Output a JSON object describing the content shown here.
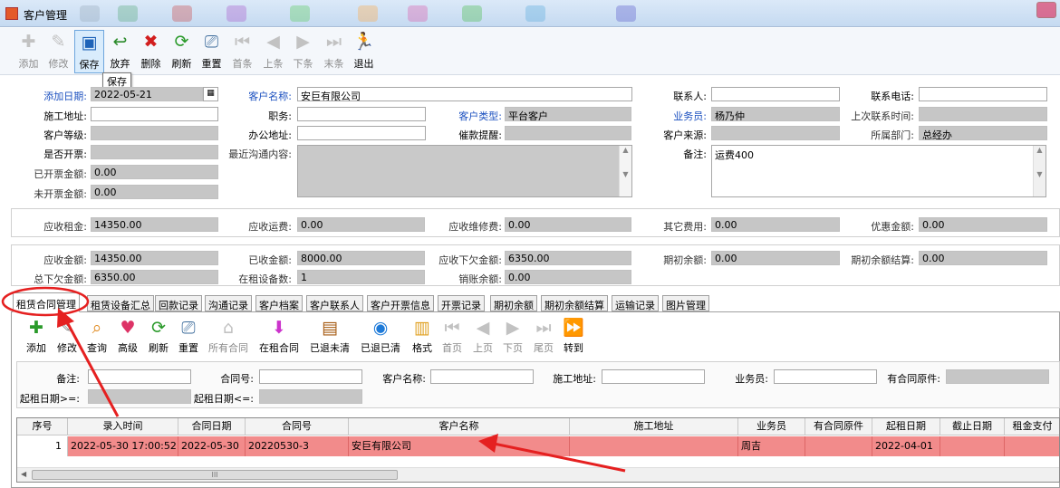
{
  "window": {
    "title": "客户管理"
  },
  "toolbar": {
    "buttons": [
      {
        "label": "添加",
        "icon": "plus-icon",
        "enabled": false
      },
      {
        "label": "修改",
        "icon": "edit-icon",
        "enabled": false
      },
      {
        "label": "保存",
        "icon": "save-icon",
        "enabled": true
      },
      {
        "label": "放弃",
        "icon": "undo-icon",
        "enabled": true
      },
      {
        "label": "删除",
        "icon": "delete-icon",
        "enabled": true
      },
      {
        "label": "刷新",
        "icon": "refresh-icon",
        "enabled": true
      },
      {
        "label": "重置",
        "icon": "reset-icon",
        "enabled": true
      },
      {
        "label": "首条",
        "icon": "first-icon",
        "enabled": false
      },
      {
        "label": "上条",
        "icon": "prev-icon",
        "enabled": false
      },
      {
        "label": "下条",
        "icon": "next-icon",
        "enabled": false
      },
      {
        "label": "末条",
        "icon": "last-icon",
        "enabled": false
      },
      {
        "label": "退出",
        "icon": "exit-icon",
        "enabled": true
      }
    ],
    "tooltip": "保存"
  },
  "form": {
    "add_date_label": "添加日期:",
    "add_date": "2022-05-21",
    "customer_name_label": "客户名称:",
    "customer_name": "安巨有限公司",
    "contact_label": "联系人:",
    "contact": "",
    "phone_label": "联系电话:",
    "phone": "",
    "site_label": "施工地址:",
    "site": "",
    "position_label": "职务:",
    "position": "",
    "ctype_label": "客户类型:",
    "ctype": "平台客户",
    "salesman_label": "业务员:",
    "salesman": "杨乃仲",
    "last_contact_label": "上次联系时间:",
    "last_contact": "",
    "level_label": "客户等级:",
    "level": "",
    "office_label": "办公地址:",
    "office": "",
    "remind_label": "催款提醒:",
    "remind": "",
    "source_label": "客户来源:",
    "source": "",
    "dept_label": "所属部门:",
    "dept": "总经办",
    "invoice_label": "是否开票:",
    "invoice": "",
    "recent_label": "最近沟通内容:",
    "recent": "",
    "note_label": "备注:",
    "note": "运费400",
    "invoiced_label": "已开票金额:",
    "invoiced": "0.00",
    "uninvoiced_label": "未开票金额:",
    "uninvoiced": "0.00"
  },
  "receivable": {
    "rent_label": "应收租金:",
    "rent": "14350.00",
    "freight_label": "应收运费:",
    "freight": "0.00",
    "repair_label": "应收维修费:",
    "repair": "0.00",
    "other_label": "其它费用:",
    "other": "0.00",
    "discount_label": "优惠金额:",
    "discount": "0.00"
  },
  "totals": {
    "total_label": "应收金额:",
    "total": "14350.00",
    "received_label": "已收金额:",
    "received": "8000.00",
    "owe_next_label": "应收下欠金额:",
    "owe_next": "6350.00",
    "opening_label": "期初余额:",
    "opening": "0.00",
    "opening_settle_label": "期初余额结算:",
    "opening_settle": "0.00",
    "total_owe_label": "总下欠金额:",
    "total_owe": "6350.00",
    "rented_count_label": "在租设备数:",
    "rented_count": "1",
    "writeoff_label": "销账余额:",
    "writeoff": "0.00"
  },
  "tabs": [
    "租赁合同管理",
    "租赁设备汇总",
    "回款记录",
    "沟通记录",
    "客户档案",
    "客户联系人",
    "客户开票信息",
    "开票记录",
    "期初余额",
    "期初余额结算",
    "运输记录",
    "图片管理"
  ],
  "subtoolbar": {
    "buttons": [
      {
        "label": "添加",
        "icon": "plus-icon",
        "enabled": true
      },
      {
        "label": "修改",
        "icon": "edit-icon",
        "enabled": true
      },
      {
        "label": "查询",
        "icon": "search-icon",
        "enabled": true
      },
      {
        "label": "高级",
        "icon": "advanced-search-icon",
        "enabled": true
      },
      {
        "label": "刷新",
        "icon": "refresh-icon",
        "enabled": true
      },
      {
        "label": "重置",
        "icon": "reset-icon",
        "enabled": true
      },
      {
        "label": "所有合同",
        "icon": "home-icon",
        "enabled": false
      },
      {
        "label": "在租合同",
        "icon": "rent-icon",
        "enabled": true
      },
      {
        "label": "已退未清",
        "icon": "returned-icon",
        "enabled": true
      },
      {
        "label": "已退已清",
        "icon": "cleared-icon",
        "enabled": true
      },
      {
        "label": "格式",
        "icon": "format-icon",
        "enabled": true
      },
      {
        "label": "首页",
        "icon": "first-icon",
        "enabled": false
      },
      {
        "label": "上页",
        "icon": "prev-icon",
        "enabled": false
      },
      {
        "label": "下页",
        "icon": "next-icon",
        "enabled": false
      },
      {
        "label": "尾页",
        "icon": "last-icon",
        "enabled": false
      },
      {
        "label": "转到",
        "icon": "goto-icon",
        "enabled": true
      }
    ]
  },
  "filter": {
    "note_label": "备注:",
    "contract_no_label": "合同号:",
    "cname_label": "客户名称:",
    "site_label": "施工地址:",
    "salesman_label": "业务员:",
    "original_label": "有合同原件:",
    "start_ge_label": "起租日期>=:",
    "start_le_label": "起租日期<=:"
  },
  "grid": {
    "columns": [
      "序号",
      "录入时间",
      "合同日期",
      "合同号",
      "客户名称",
      "施工地址",
      "业务员",
      "有合同原件",
      "起租日期",
      "截止日期",
      "租金支付"
    ],
    "rows": [
      [
        "1",
        "2022-05-30 17:00:52",
        "2022-05-30",
        "20220530-3",
        "安巨有限公司",
        "",
        "周吉",
        "",
        "2022-04-01",
        "",
        ""
      ]
    ]
  },
  "colors": {
    "annotation_red": "#e52020",
    "selected_row": "#f28b8b",
    "label_blue": "#1a4fbf"
  }
}
